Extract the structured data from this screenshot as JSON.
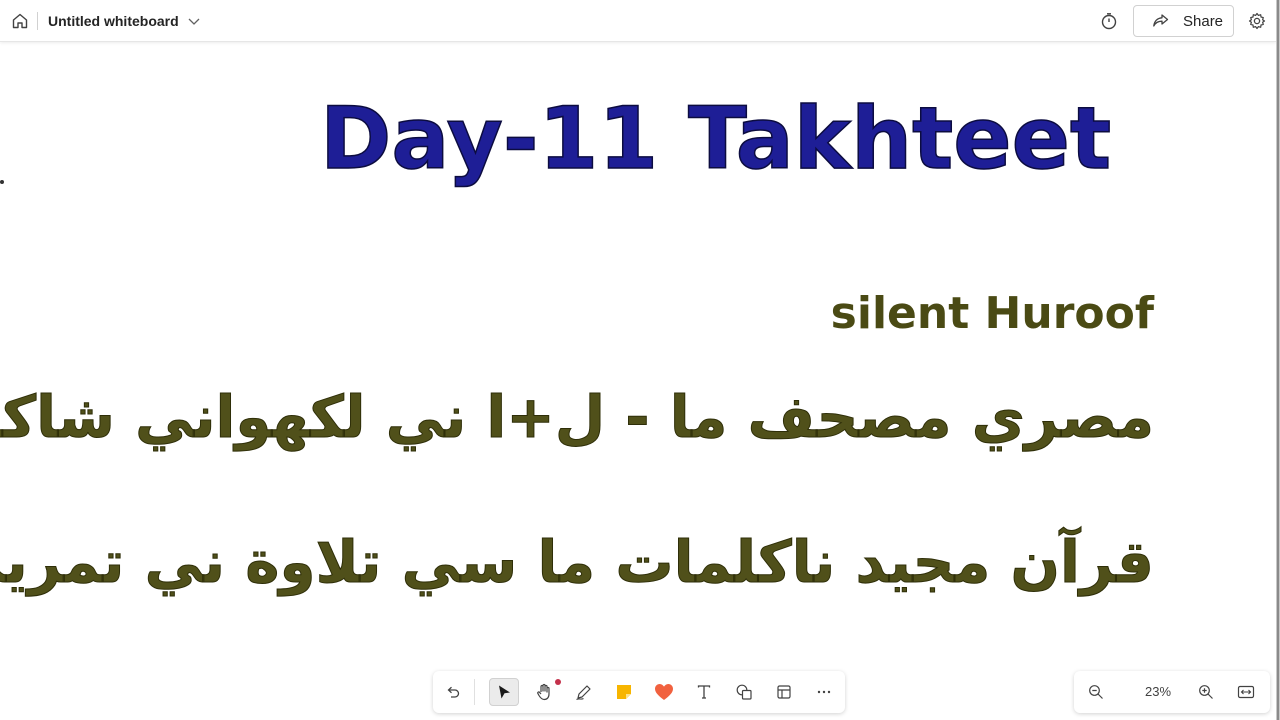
{
  "header": {
    "title": "Untitled whiteboard",
    "share_label": "Share",
    "icons": [
      "home-icon",
      "chevron-down-icon",
      "timer-icon",
      "share-icon",
      "gear-icon"
    ]
  },
  "canvas": {
    "title": "Day-11 Takhteet",
    "subtitle": "silent Huroof",
    "arabic_lines": [
      "مصري مصحف ما - ل+ا   ني لكهواني شاكلة",
      "قرآن مجيد  ناكلمات ما سي تلاوة ني تمرين"
    ],
    "colors": {
      "title": "#1e1e96",
      "text": "#4a4a14"
    }
  },
  "toolbar": {
    "tools": [
      "undo-icon",
      "select-icon",
      "hand-icon",
      "pen-icon",
      "sticky-note-icon",
      "reaction-heart-icon",
      "text-icon",
      "shapes-icon",
      "templates-icon",
      "more-icon"
    ],
    "active_tool": "select-icon"
  },
  "zoom": {
    "level": "23%",
    "icons": [
      "zoom-out-icon",
      "zoom-in-icon",
      "fit-to-screen-icon"
    ]
  }
}
